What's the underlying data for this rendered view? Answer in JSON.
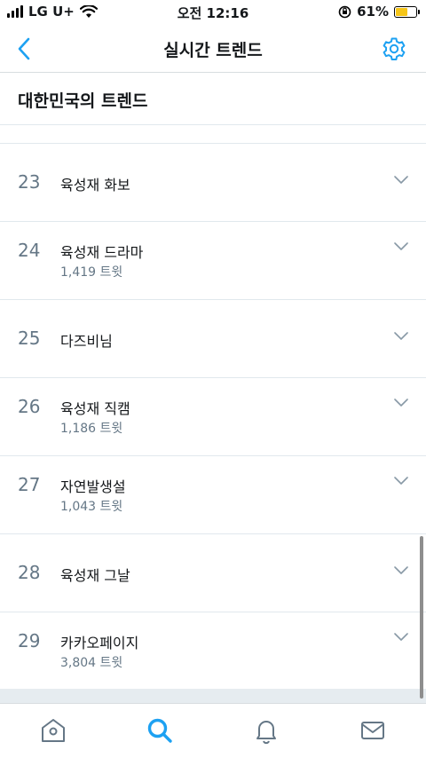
{
  "status_bar": {
    "carrier": "LG U+",
    "time": "오전 12:16",
    "battery_percent": "61%",
    "battery_level": 0.61,
    "battery_color": "#f5c518"
  },
  "nav": {
    "title": "실시간 트렌드",
    "back_icon": "chevron-left-icon",
    "settings_icon": "gear-icon",
    "accent_color": "#1da1f2"
  },
  "section": {
    "title": "대한민국의 트렌드"
  },
  "trends": [
    {
      "rank": "23",
      "name": "육성재 화보",
      "count": ""
    },
    {
      "rank": "24",
      "name": "육성재 드라마",
      "count": "1,419 트윗"
    },
    {
      "rank": "25",
      "name": "다즈비님",
      "count": ""
    },
    {
      "rank": "26",
      "name": "육성재 직캠",
      "count": "1,186 트윗"
    },
    {
      "rank": "27",
      "name": "자연발생설",
      "count": "1,043 트윗"
    },
    {
      "rank": "28",
      "name": "육성재 그날",
      "count": ""
    },
    {
      "rank": "29",
      "name": "카카오페이지",
      "count": "3,804 트윗"
    }
  ],
  "tab_bar": {
    "tabs": [
      {
        "icon": "home-icon",
        "active": false
      },
      {
        "icon": "search-icon",
        "active": true
      },
      {
        "icon": "bell-icon",
        "active": false
      },
      {
        "icon": "mail-icon",
        "active": false
      }
    ]
  }
}
